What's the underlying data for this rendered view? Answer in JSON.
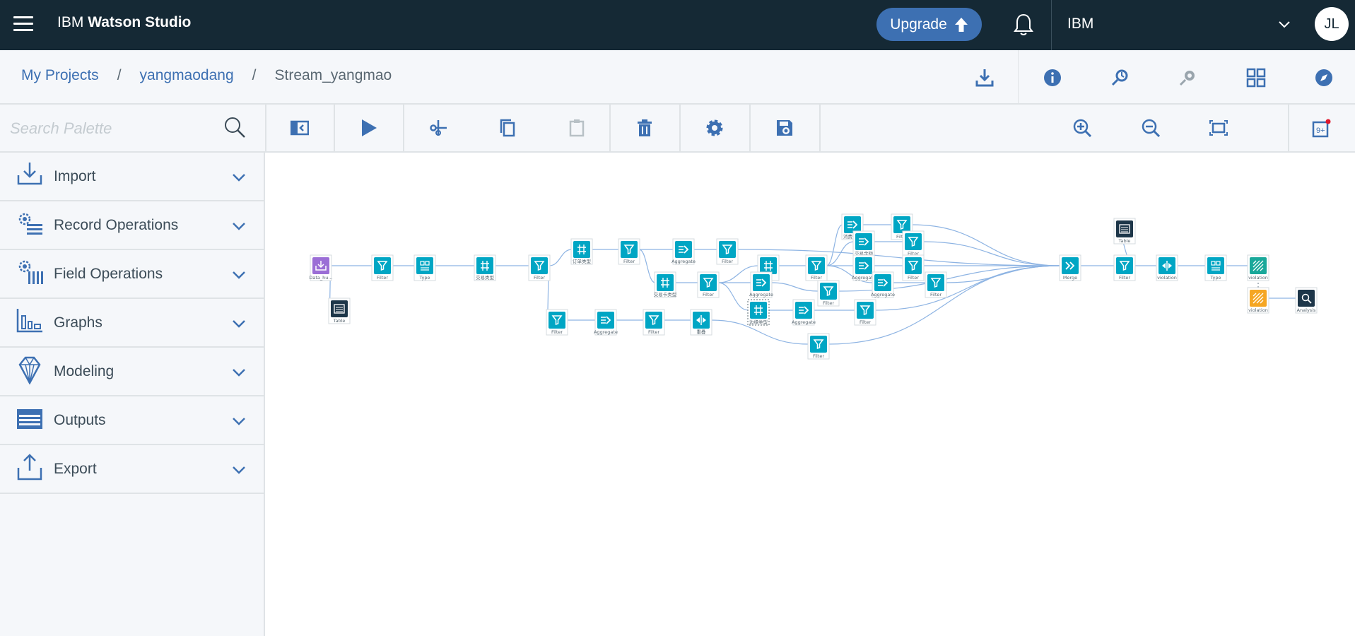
{
  "app": {
    "brand_prefix": "IBM",
    "brand_name": "Watson Studio",
    "upgrade_label": "Upgrade",
    "account_name": "IBM",
    "avatar_initials": "JL"
  },
  "breadcrumb": {
    "items": [
      "My Projects",
      "yangmaodang",
      "Stream_yangmao"
    ],
    "separator": "/"
  },
  "header_icons": [
    "download-icon",
    "info-icon",
    "run-history-icon",
    "assets-icon",
    "grid-icon",
    "compass-icon"
  ],
  "palette": {
    "search_placeholder": "Search Palette",
    "items": [
      {
        "label": "Import",
        "icon": "import-icon"
      },
      {
        "label": "Record Operations",
        "icon": "record-operations-icon"
      },
      {
        "label": "Field Operations",
        "icon": "field-operations-icon"
      },
      {
        "label": "Graphs",
        "icon": "graphs-icon"
      },
      {
        "label": "Modeling",
        "icon": "modeling-icon"
      },
      {
        "label": "Outputs",
        "icon": "outputs-icon"
      },
      {
        "label": "Export",
        "icon": "export-icon"
      }
    ]
  },
  "toolbar": {
    "buttons": [
      "toggle-palette-icon",
      "run-icon",
      "cut-icon",
      "copy-icon",
      "paste-icon",
      "delete-icon",
      "settings-icon",
      "save-icon",
      "zoom-in-icon",
      "zoom-out-icon",
      "fit-to-screen-icon",
      "notifications-icon"
    ]
  },
  "colors": {
    "topbar": "#152935",
    "accent": "#3d70b2",
    "node_teal": "#00a6c4",
    "node_dark": "#1d3649",
    "node_purple": "#9b6ed6",
    "node_orange": "#f5a623",
    "node_green": "#19a89a",
    "link": "#8eb4e3"
  },
  "flow": {
    "nodes": [
      {
        "id": "n1",
        "label": "Data_hu...",
        "kind": "import",
        "color": "purple"
      },
      {
        "id": "n2",
        "label": "Table",
        "kind": "table",
        "color": "dark"
      },
      {
        "id": "n3",
        "label": "Filter",
        "kind": "filter",
        "color": "teal"
      },
      {
        "id": "n4",
        "label": "Type",
        "kind": "type",
        "color": "teal"
      },
      {
        "id": "n5",
        "label": "交易类型",
        "kind": "derive",
        "color": "teal"
      },
      {
        "id": "n6",
        "label": "Filter",
        "kind": "filter",
        "color": "teal"
      },
      {
        "id": "n7",
        "label": "订单类型",
        "kind": "derive",
        "color": "teal"
      },
      {
        "id": "n8",
        "label": "Filter",
        "kind": "filter",
        "color": "teal"
      },
      {
        "id": "n9",
        "label": "Aggregate",
        "kind": "aggregate",
        "color": "teal"
      },
      {
        "id": "n10",
        "label": "Filter",
        "kind": "filter",
        "color": "teal"
      },
      {
        "id": "n11",
        "label": "交易卡类型",
        "kind": "derive",
        "color": "teal"
      },
      {
        "id": "n12",
        "label": "Filter",
        "kind": "filter",
        "color": "teal"
      },
      {
        "id": "n13",
        "label": "Filter",
        "kind": "filter",
        "color": "teal"
      },
      {
        "id": "n14",
        "label": "Aggregate",
        "kind": "aggregate",
        "color": "teal"
      },
      {
        "id": "n15",
        "label": "Filter",
        "kind": "filter",
        "color": "teal"
      },
      {
        "id": "n16",
        "label": "重叠",
        "kind": "partition",
        "color": "teal"
      },
      {
        "id": "n17",
        "label": "...",
        "kind": "derive",
        "color": "teal"
      },
      {
        "id": "n18",
        "label": "Aggregate",
        "kind": "aggregate",
        "color": "teal"
      },
      {
        "id": "n19",
        "label": "边缘类型",
        "kind": "derive",
        "color": "teal"
      },
      {
        "id": "n20",
        "label": "Filter",
        "kind": "filter",
        "color": "teal"
      },
      {
        "id": "n21",
        "label": "Filter",
        "kind": "filter",
        "color": "teal"
      },
      {
        "id": "n22",
        "label": "Filter",
        "kind": "filter",
        "color": "teal"
      },
      {
        "id": "n23",
        "label": "Aggregate",
        "kind": "aggregate",
        "color": "teal"
      },
      {
        "id": "n24",
        "label": "消费时间",
        "kind": "aggregate",
        "color": "teal"
      },
      {
        "id": "n25",
        "label": "交易金额",
        "kind": "aggregate",
        "color": "teal"
      },
      {
        "id": "n26",
        "label": "Aggregate",
        "kind": "aggregate",
        "color": "teal"
      },
      {
        "id": "n27",
        "label": "Aggregate",
        "kind": "aggregate",
        "color": "teal"
      },
      {
        "id": "n28",
        "label": "Filter",
        "kind": "filter",
        "color": "teal"
      },
      {
        "id": "n29",
        "label": "Filter",
        "kind": "filter",
        "color": "teal"
      },
      {
        "id": "n30",
        "label": "Filter",
        "kind": "filter",
        "color": "teal"
      },
      {
        "id": "n31",
        "label": "Filter",
        "kind": "filter",
        "color": "teal"
      },
      {
        "id": "n32",
        "label": "Filter",
        "kind": "filter",
        "color": "teal"
      },
      {
        "id": "n33",
        "label": "Merge",
        "kind": "merge",
        "color": "teal"
      },
      {
        "id": "n34",
        "label": "Filter",
        "kind": "filter",
        "color": "teal"
      },
      {
        "id": "n35",
        "label": "Table",
        "kind": "table",
        "color": "dark"
      },
      {
        "id": "n36",
        "label": "violation",
        "kind": "partition",
        "color": "teal"
      },
      {
        "id": "n37",
        "label": "Type",
        "kind": "type",
        "color": "teal"
      },
      {
        "id": "n38",
        "label": "violation",
        "kind": "model",
        "color": "green"
      },
      {
        "id": "n39",
        "label": "violation",
        "kind": "model-nugget",
        "color": "orange"
      },
      {
        "id": "n40",
        "label": "Analysis",
        "kind": "analysis",
        "color": "dark"
      }
    ]
  }
}
